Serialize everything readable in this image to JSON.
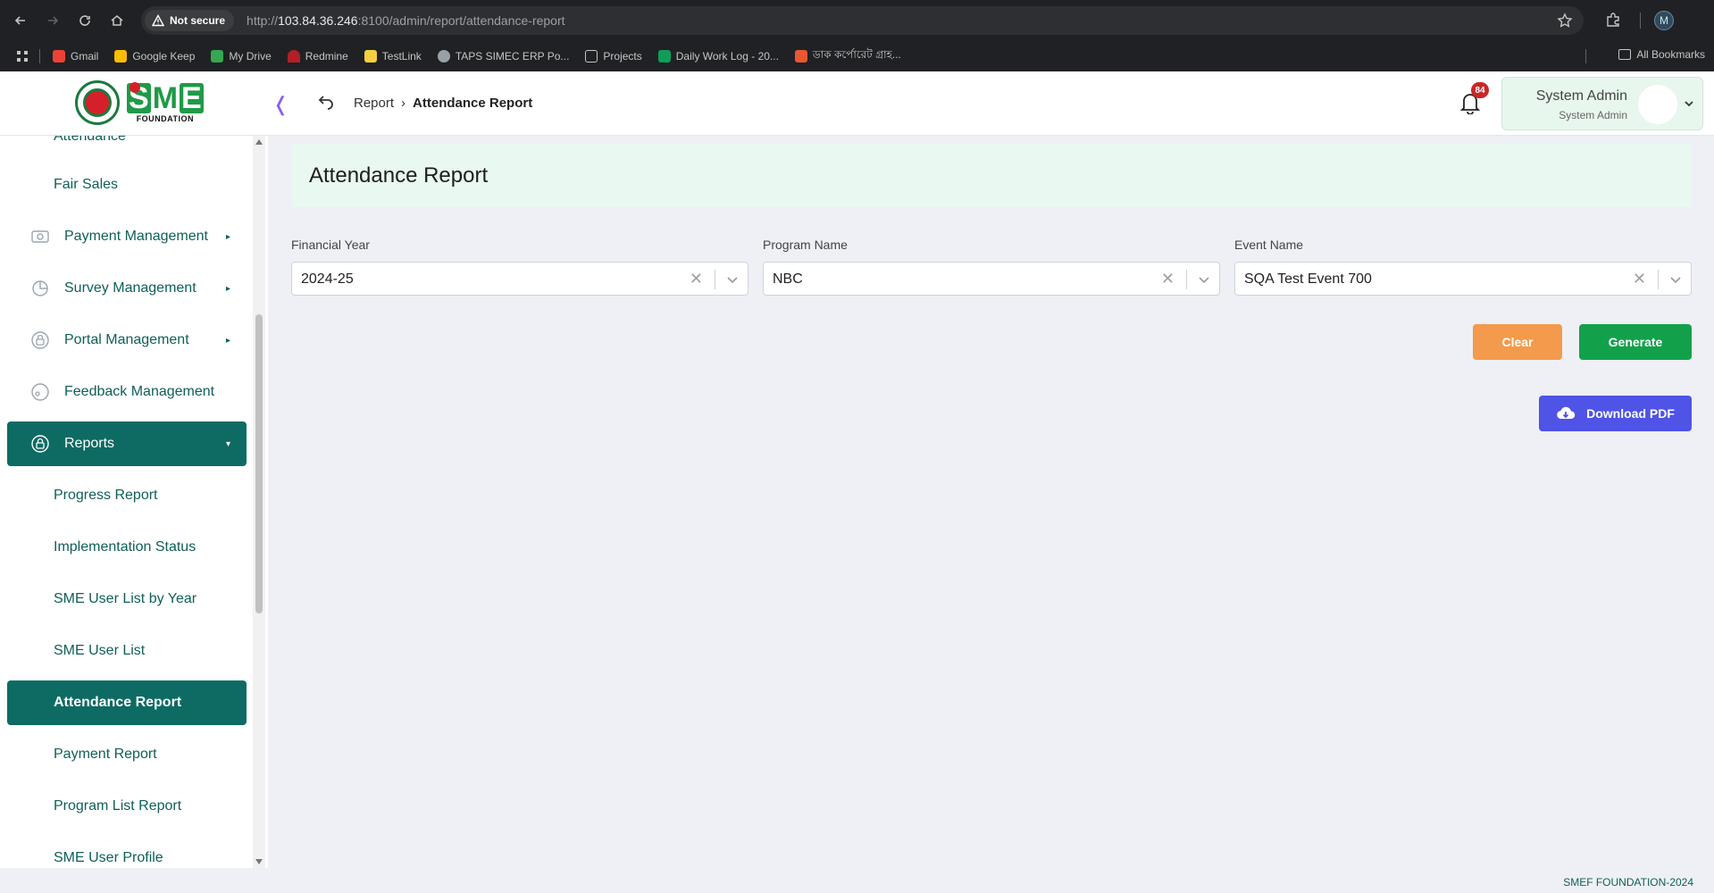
{
  "browser": {
    "security_label": "Not secure",
    "url_scheme": "http://",
    "url_host": "103.84.36.246",
    "url_rest": ":8100/admin/report/attendance-report",
    "profile_initial": "M",
    "bookmarks": [
      {
        "label": "Gmail",
        "color": "#ea4335"
      },
      {
        "label": "Google Keep",
        "color": "#fbbc04"
      },
      {
        "label": "My Drive",
        "color": "#34a853"
      },
      {
        "label": "Redmine",
        "color": "#b32024"
      },
      {
        "label": "TestLink",
        "color": "#f4d03f"
      },
      {
        "label": "TAPS SIMEC ERP Po...",
        "color": "#9aa0a6"
      },
      {
        "label": "Projects",
        "color": "#9aa0a6"
      },
      {
        "label": "Daily Work Log - 20...",
        "color": "#0f9d58"
      },
      {
        "label": "ডাক কর্পোরেট গ্রাহ...",
        "color": "#e8572f"
      }
    ],
    "all_bookmarks": "All Bookmarks"
  },
  "header": {
    "logo_text": "SME",
    "logo_sub": "FOUNDATION",
    "breadcrumb_parent": "Report",
    "breadcrumb_current": "Attendance Report",
    "notification_count": "84",
    "user_name": "System Admin",
    "user_role": "System Admin"
  },
  "sidebar": {
    "cut_item": "Attendance",
    "items": [
      {
        "label": "Fair Sales"
      },
      {
        "label": "Payment Management"
      },
      {
        "label": "Survey Management"
      },
      {
        "label": "Portal Management"
      },
      {
        "label": "Feedback Management"
      },
      {
        "label": "Reports"
      },
      {
        "label": "Progress Report"
      },
      {
        "label": "Implementation Status"
      },
      {
        "label": "SME User List by Year"
      },
      {
        "label": "SME User List"
      },
      {
        "label": "Attendance Report"
      },
      {
        "label": "Payment Report"
      },
      {
        "label": "Program List Report"
      },
      {
        "label": "SME User Profile"
      }
    ]
  },
  "main": {
    "title": "Attendance Report",
    "fields": [
      {
        "label": "Financial Year",
        "value": "2024-25"
      },
      {
        "label": "Program Name",
        "value": "NBC"
      },
      {
        "label": "Event Name",
        "value": "SQA Test Event 700"
      }
    ],
    "clear_label": "Clear",
    "generate_label": "Generate",
    "download_label": "Download PDF"
  },
  "footer": {
    "text": "SMEF FOUNDATION-2024"
  }
}
